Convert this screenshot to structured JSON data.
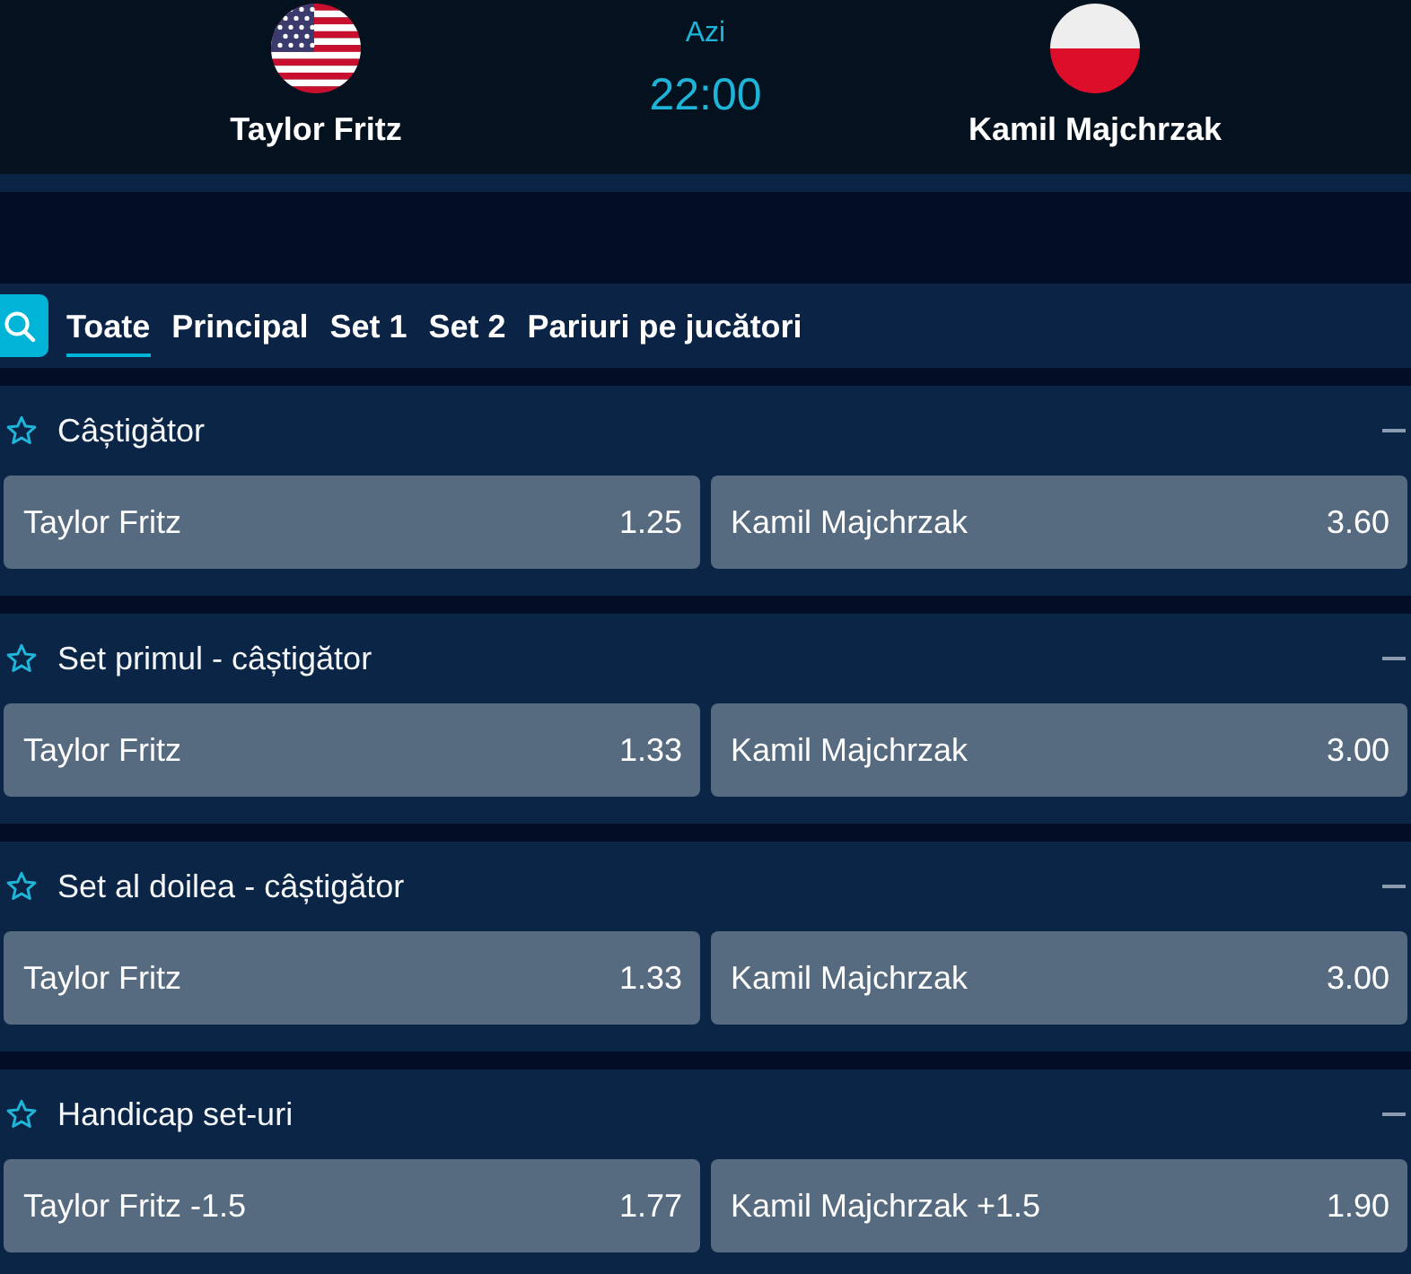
{
  "match": {
    "players": [
      {
        "name": "Taylor Fritz",
        "kind": "us"
      },
      {
        "name": "Kamil Majchrzak",
        "kind": "pl"
      }
    ],
    "day": "Azi",
    "time": "22:00"
  },
  "tabs": [
    {
      "label": "Toate",
      "selected": true
    },
    {
      "label": "Principal",
      "selected": false
    },
    {
      "label": "Set 1",
      "selected": false
    },
    {
      "label": "Set 2",
      "selected": false
    },
    {
      "label": "Pariuri pe jucători",
      "selected": false
    }
  ],
  "markets": [
    {
      "title": "Câștigător",
      "favorite": false,
      "expanded": true,
      "outcomes": [
        {
          "label": "Taylor Fritz",
          "odds": "1.25"
        },
        {
          "label": "Kamil Majchrzak",
          "odds": "3.60"
        }
      ]
    },
    {
      "title": "Set primul - câștigător",
      "favorite": false,
      "expanded": true,
      "outcomes": [
        {
          "label": "Taylor Fritz",
          "odds": "1.33"
        },
        {
          "label": "Kamil Majchrzak",
          "odds": "3.00"
        }
      ]
    },
    {
      "title": "Set al doilea - câștigător",
      "favorite": false,
      "expanded": true,
      "outcomes": [
        {
          "label": "Taylor Fritz",
          "odds": "1.33"
        },
        {
          "label": "Kamil Majchrzak",
          "odds": "3.00"
        }
      ]
    },
    {
      "title": "Handicap set-uri",
      "favorite": false,
      "expanded": true,
      "outcomes": [
        {
          "label": "Taylor Fritz -1.5",
          "odds": "1.77"
        },
        {
          "label": "Kamil Majchrzak +1.5",
          "odds": "1.90"
        }
      ]
    }
  ]
}
